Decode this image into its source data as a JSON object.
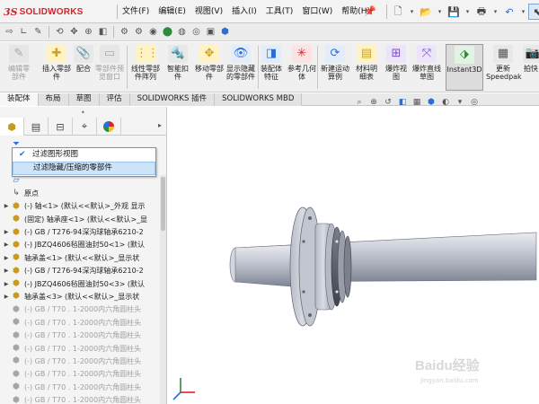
{
  "app": {
    "logo_ds": "3S",
    "logo_text": "SOLIDWORKS"
  },
  "menu": {
    "items": [
      "文件(F)",
      "编辑(E)",
      "视图(V)",
      "插入(I)",
      "工具(T)",
      "窗口(W)",
      "帮助(H)"
    ],
    "pin_icon": "pin-icon"
  },
  "ribbon": {
    "buttons": [
      {
        "label": "编辑零部件",
        "icon": "edit-component-icon",
        "disabled": true
      },
      {
        "label": "插入零部件",
        "icon": "insert-component-icon",
        "disabled": false
      },
      {
        "label": "配合",
        "icon": "mate-icon",
        "disabled": false
      },
      {
        "label": "零部件预览窗口",
        "icon": "component-preview-icon",
        "disabled": true
      },
      {
        "label": "线性零部件阵列",
        "icon": "linear-pattern-icon",
        "disabled": false
      },
      {
        "label": "智能扣件",
        "icon": "smart-fastener-icon",
        "disabled": false
      },
      {
        "label": "移动零部件",
        "icon": "move-component-icon",
        "disabled": false
      },
      {
        "label": "显示隐藏的零部件",
        "icon": "show-hidden-icon",
        "disabled": false
      },
      {
        "label": "装配体特征",
        "icon": "assembly-feature-icon",
        "disabled": false
      },
      {
        "label": "参考几何体",
        "icon": "reference-geometry-icon",
        "disabled": false
      },
      {
        "label": "新建运动算例",
        "icon": "motion-study-icon",
        "disabled": false
      },
      {
        "label": "材料明细表",
        "icon": "bom-icon",
        "disabled": false
      },
      {
        "label": "爆炸视图",
        "icon": "exploded-view-icon",
        "disabled": false
      },
      {
        "label": "爆炸直线草图",
        "icon": "explode-line-sketch-icon",
        "disabled": false
      },
      {
        "label": "Instant3D",
        "icon": "instant3d-icon",
        "disabled": false,
        "active": true
      },
      {
        "label": "更新Speedpak",
        "icon": "speedpak-icon",
        "disabled": false
      },
      {
        "label": "拍快",
        "icon": "snapshot-icon",
        "disabled": false
      }
    ]
  },
  "tabs": [
    "装配体",
    "布局",
    "草图",
    "评估",
    "SOLIDWORKS 插件",
    "SOLIDWORKS MBD"
  ],
  "dropdown": {
    "items": [
      {
        "label": "过滤图形视图",
        "checked": true
      },
      {
        "label": "过滤隐藏/压缩的零部件",
        "checked": false,
        "highlighted": true
      }
    ]
  },
  "tree": {
    "rows": [
      {
        "text": "",
        "icon": "plane",
        "expand": "",
        "gray": false
      },
      {
        "text": "",
        "icon": "plane",
        "expand": "",
        "gray": false
      },
      {
        "text": "",
        "icon": "plane",
        "expand": "",
        "gray": false
      },
      {
        "text": "原点",
        "icon": "origin",
        "expand": "",
        "gray": false
      },
      {
        "text": "(-) 轴<1> (默认<<默认>_外观 显示",
        "icon": "part",
        "expand": "▶",
        "gray": false
      },
      {
        "text": "(固定) 轴承座<1> (默认<<默认>_显",
        "icon": "part",
        "expand": "",
        "gray": false
      },
      {
        "text": "(-) GB / T276-94深沟球轴承6210-2",
        "icon": "part",
        "expand": "▶",
        "gray": false
      },
      {
        "text": "(-) JBZQ4606毡圈油封50<1> (默认",
        "icon": "part",
        "expand": "▶",
        "gray": false
      },
      {
        "text": "轴承盖<1> (默认<<默认>_显示状",
        "icon": "part",
        "expand": "▶",
        "gray": false
      },
      {
        "text": "(-) GB / T276-94深沟球轴承6210-2",
        "icon": "part",
        "expand": "▶",
        "gray": false
      },
      {
        "text": "(-) JBZQ4606毡圈油封50<3> (默认",
        "icon": "part",
        "expand": "▶",
        "gray": false
      },
      {
        "text": "轴承盖<3> (默认<<默认>_显示状",
        "icon": "part",
        "expand": "▶",
        "gray": false
      },
      {
        "text": "(-) GB / T70 . 1-2000内六角圆柱头",
        "icon": "partg",
        "expand": "",
        "gray": true
      },
      {
        "text": "(-) GB / T70 . 1-2000内六角圆柱头",
        "icon": "partg",
        "expand": "",
        "gray": true
      },
      {
        "text": "(-) GB / T70 . 1-2000内六角圆柱头",
        "icon": "partg",
        "expand": "",
        "gray": true
      },
      {
        "text": "(-) GB / T70 . 1-2000内六角圆柱头",
        "icon": "partg",
        "expand": "",
        "gray": true
      },
      {
        "text": "(-) GB / T70 . 1-2000内六角圆柱头",
        "icon": "partg",
        "expand": "",
        "gray": true
      },
      {
        "text": "(-) GB / T70 . 1-2000内六角圆柱头",
        "icon": "partg",
        "expand": "",
        "gray": true
      },
      {
        "text": "(-) GB / T70 . 1-2000内六角圆柱头",
        "icon": "partg",
        "expand": "",
        "gray": true
      },
      {
        "text": "(-) GB / T70 . 1-2000内六角圆柱头",
        "icon": "partg",
        "expand": "",
        "gray": true
      }
    ]
  },
  "watermark": {
    "text": "Baidu经验",
    "sub": "jingyan.baidu.com"
  },
  "colors": {
    "brand_red": "#d6232a",
    "accent_blue": "#2a6fd6",
    "part_yellow": "#c99a1c",
    "shaft_gray": "#b8bcc6"
  }
}
